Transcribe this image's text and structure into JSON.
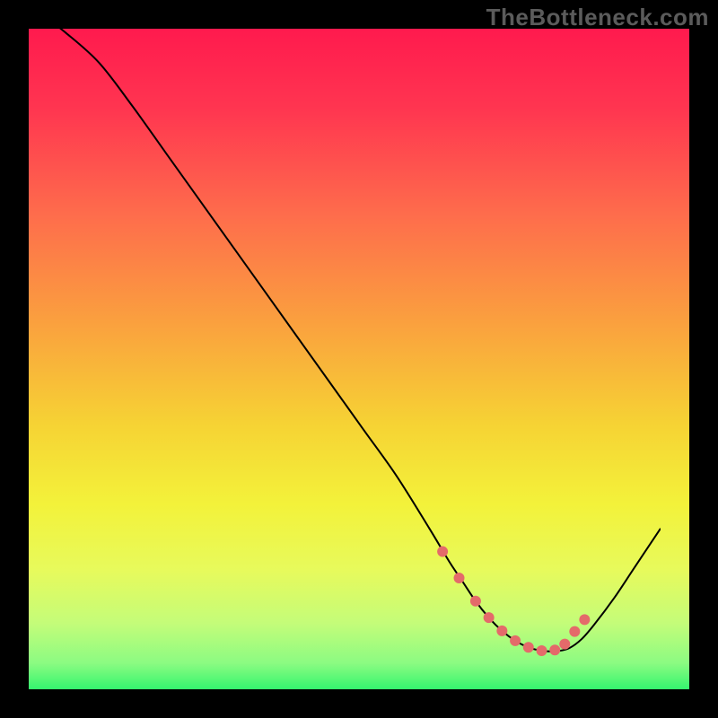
{
  "watermark": "TheBottleneck.com",
  "chart_data": {
    "type": "line",
    "title": "",
    "xlabel": "",
    "ylabel": "",
    "xlim": [
      0,
      100
    ],
    "ylim": [
      0,
      100
    ],
    "grid": false,
    "series": [
      {
        "name": "bottleneck-curve",
        "x": [
          3,
          6,
          10,
          15,
          20,
          25,
          30,
          35,
          40,
          45,
          50,
          55,
          60,
          65,
          68,
          70,
          72,
          74,
          76,
          78,
          80,
          82,
          84,
          86,
          88,
          90,
          93,
          96,
          100
        ],
        "y": [
          100,
          98,
          95,
          90.5,
          84,
          77,
          70,
          63,
          56,
          49,
          42,
          35,
          28,
          20,
          15,
          12,
          9,
          6.5,
          4.5,
          3,
          2,
          1.5,
          1.4,
          1.8,
          3.2,
          5.5,
          9.5,
          14,
          20
        ],
        "color": "#000000",
        "line_width": 2
      }
    ],
    "markers": {
      "name": "optimal-range-markers",
      "x": [
        67,
        69.5,
        72,
        74,
        76,
        78,
        80,
        82,
        84,
        85.5,
        87,
        88.5
      ],
      "y": [
        16.5,
        12.5,
        9,
        6.5,
        4.5,
        3,
        2,
        1.5,
        1.6,
        2.5,
        4.4,
        6.2
      ],
      "color": "#E46A6A",
      "radius": 6
    },
    "background_gradient": {
      "type": "vertical",
      "stops": [
        {
          "offset": 0.0,
          "color": "#FF1A4E"
        },
        {
          "offset": 0.12,
          "color": "#FF3550"
        },
        {
          "offset": 0.28,
          "color": "#FE6C4C"
        },
        {
          "offset": 0.45,
          "color": "#FAA23E"
        },
        {
          "offset": 0.6,
          "color": "#F6D334"
        },
        {
          "offset": 0.72,
          "color": "#F3F23A"
        },
        {
          "offset": 0.82,
          "color": "#E7FA5C"
        },
        {
          "offset": 0.9,
          "color": "#C4FC79"
        },
        {
          "offset": 0.96,
          "color": "#8CFB82"
        },
        {
          "offset": 1.0,
          "color": "#35F56E"
        }
      ]
    }
  }
}
